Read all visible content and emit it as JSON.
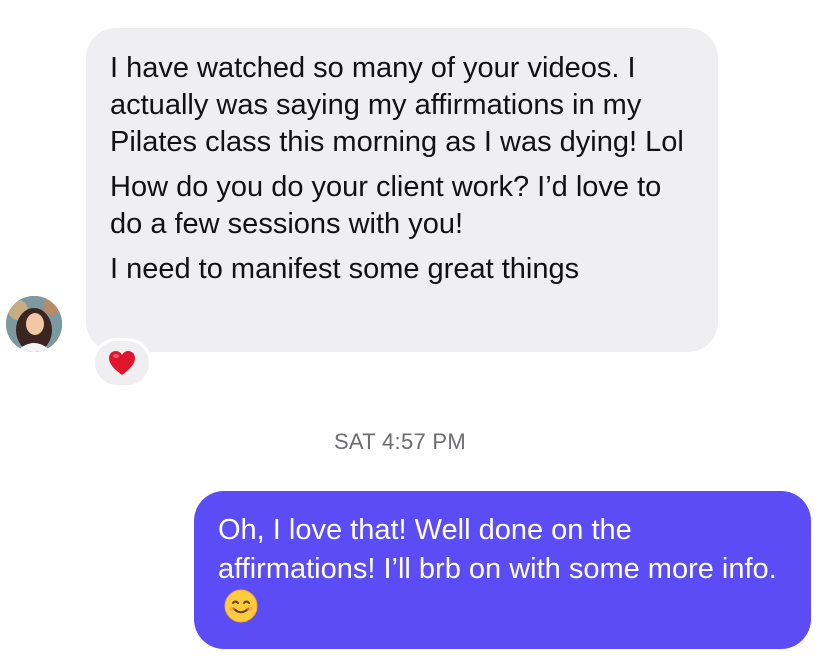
{
  "incoming": {
    "paragraphs": [
      "I have watched so many of your videos. I actually was saying my affirmations in my Pilates class this morning as I was dying! Lol",
      "How do you do your client work? I’d love to do a few sessions with you!",
      "I need to manifest some great things"
    ],
    "reaction": "heart-icon"
  },
  "timestamp": "SAT 4:57 PM",
  "outgoing": {
    "text": "Oh, I love that! Well done on the affirmations! I’ll brb on with some more info.",
    "emoji": "smiling-face-icon"
  },
  "colors": {
    "incoming_bubble": "#efeff1",
    "outgoing_bubble": "#5b4cf5",
    "timestamp": "#6d6d72",
    "heart": "#e0142b"
  }
}
